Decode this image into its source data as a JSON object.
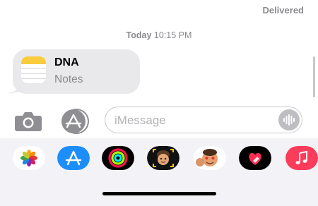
{
  "status": {
    "delivered": "Delivered"
  },
  "thread": {
    "timestamp_day": "Today",
    "timestamp_time": "10:15 PM"
  },
  "card": {
    "title": "DNA",
    "subtitle": "Notes",
    "icon": "notes-app-icon"
  },
  "input": {
    "placeholder": "iMessage",
    "camera_icon": "camera-icon",
    "apps_icon": "app-store-icon",
    "audio_icon": "waveform-icon"
  },
  "drawer_apps": [
    {
      "name": "Photos",
      "icon": "photos-icon"
    },
    {
      "name": "App Store",
      "icon": "app-store-icon"
    },
    {
      "name": "Activity",
      "icon": "activity-rings-icon"
    },
    {
      "name": "Memoji Stickers",
      "icon": "memoji-icon"
    },
    {
      "name": "Animoji",
      "icon": "animoji-icon"
    },
    {
      "name": "Digital Touch",
      "icon": "digital-touch-icon"
    },
    {
      "name": "Music",
      "icon": "music-icon"
    }
  ],
  "colors": {
    "notes_yellow": "#f8cc3c",
    "app_store_blue": "#1c8ef9",
    "music_red": "#fb3c5a",
    "bubble_gray": "#e9e9eb",
    "drawer_bg": "#f2f2f7"
  }
}
